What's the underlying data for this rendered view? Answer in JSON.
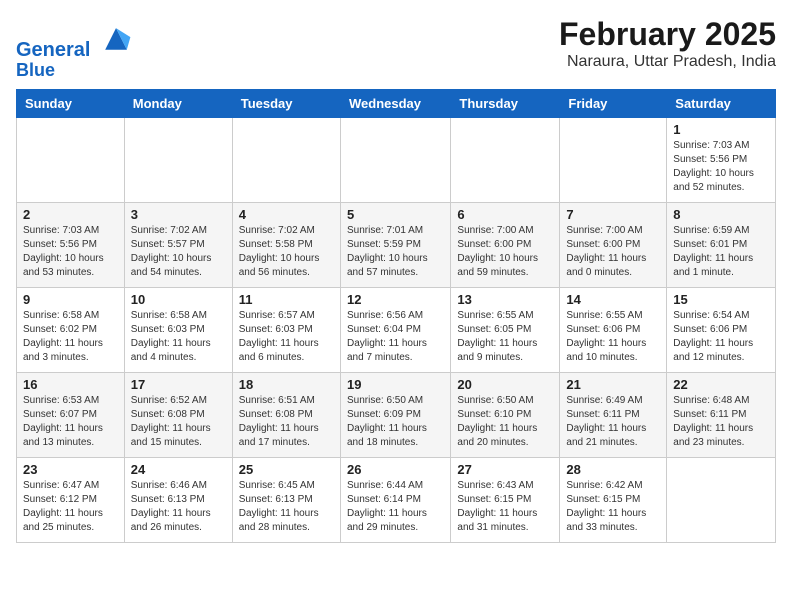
{
  "logo": {
    "line1": "General",
    "line2": "Blue"
  },
  "title": "February 2025",
  "location": "Naraura, Uttar Pradesh, India",
  "weekdays": [
    "Sunday",
    "Monday",
    "Tuesday",
    "Wednesday",
    "Thursday",
    "Friday",
    "Saturday"
  ],
  "weeks": [
    [
      {
        "day": "",
        "info": ""
      },
      {
        "day": "",
        "info": ""
      },
      {
        "day": "",
        "info": ""
      },
      {
        "day": "",
        "info": ""
      },
      {
        "day": "",
        "info": ""
      },
      {
        "day": "",
        "info": ""
      },
      {
        "day": "1",
        "info": "Sunrise: 7:03 AM\nSunset: 5:56 PM\nDaylight: 10 hours\nand 52 minutes."
      }
    ],
    [
      {
        "day": "2",
        "info": "Sunrise: 7:03 AM\nSunset: 5:56 PM\nDaylight: 10 hours\nand 53 minutes."
      },
      {
        "day": "3",
        "info": "Sunrise: 7:02 AM\nSunset: 5:57 PM\nDaylight: 10 hours\nand 54 minutes."
      },
      {
        "day": "4",
        "info": "Sunrise: 7:02 AM\nSunset: 5:58 PM\nDaylight: 10 hours\nand 56 minutes."
      },
      {
        "day": "5",
        "info": "Sunrise: 7:01 AM\nSunset: 5:59 PM\nDaylight: 10 hours\nand 57 minutes."
      },
      {
        "day": "6",
        "info": "Sunrise: 7:00 AM\nSunset: 6:00 PM\nDaylight: 10 hours\nand 59 minutes."
      },
      {
        "day": "7",
        "info": "Sunrise: 7:00 AM\nSunset: 6:00 PM\nDaylight: 11 hours\nand 0 minutes."
      },
      {
        "day": "8",
        "info": "Sunrise: 6:59 AM\nSunset: 6:01 PM\nDaylight: 11 hours\nand 1 minute."
      }
    ],
    [
      {
        "day": "9",
        "info": "Sunrise: 6:58 AM\nSunset: 6:02 PM\nDaylight: 11 hours\nand 3 minutes."
      },
      {
        "day": "10",
        "info": "Sunrise: 6:58 AM\nSunset: 6:03 PM\nDaylight: 11 hours\nand 4 minutes."
      },
      {
        "day": "11",
        "info": "Sunrise: 6:57 AM\nSunset: 6:03 PM\nDaylight: 11 hours\nand 6 minutes."
      },
      {
        "day": "12",
        "info": "Sunrise: 6:56 AM\nSunset: 6:04 PM\nDaylight: 11 hours\nand 7 minutes."
      },
      {
        "day": "13",
        "info": "Sunrise: 6:55 AM\nSunset: 6:05 PM\nDaylight: 11 hours\nand 9 minutes."
      },
      {
        "day": "14",
        "info": "Sunrise: 6:55 AM\nSunset: 6:06 PM\nDaylight: 11 hours\nand 10 minutes."
      },
      {
        "day": "15",
        "info": "Sunrise: 6:54 AM\nSunset: 6:06 PM\nDaylight: 11 hours\nand 12 minutes."
      }
    ],
    [
      {
        "day": "16",
        "info": "Sunrise: 6:53 AM\nSunset: 6:07 PM\nDaylight: 11 hours\nand 13 minutes."
      },
      {
        "day": "17",
        "info": "Sunrise: 6:52 AM\nSunset: 6:08 PM\nDaylight: 11 hours\nand 15 minutes."
      },
      {
        "day": "18",
        "info": "Sunrise: 6:51 AM\nSunset: 6:08 PM\nDaylight: 11 hours\nand 17 minutes."
      },
      {
        "day": "19",
        "info": "Sunrise: 6:50 AM\nSunset: 6:09 PM\nDaylight: 11 hours\nand 18 minutes."
      },
      {
        "day": "20",
        "info": "Sunrise: 6:50 AM\nSunset: 6:10 PM\nDaylight: 11 hours\nand 20 minutes."
      },
      {
        "day": "21",
        "info": "Sunrise: 6:49 AM\nSunset: 6:11 PM\nDaylight: 11 hours\nand 21 minutes."
      },
      {
        "day": "22",
        "info": "Sunrise: 6:48 AM\nSunset: 6:11 PM\nDaylight: 11 hours\nand 23 minutes."
      }
    ],
    [
      {
        "day": "23",
        "info": "Sunrise: 6:47 AM\nSunset: 6:12 PM\nDaylight: 11 hours\nand 25 minutes."
      },
      {
        "day": "24",
        "info": "Sunrise: 6:46 AM\nSunset: 6:13 PM\nDaylight: 11 hours\nand 26 minutes."
      },
      {
        "day": "25",
        "info": "Sunrise: 6:45 AM\nSunset: 6:13 PM\nDaylight: 11 hours\nand 28 minutes."
      },
      {
        "day": "26",
        "info": "Sunrise: 6:44 AM\nSunset: 6:14 PM\nDaylight: 11 hours\nand 29 minutes."
      },
      {
        "day": "27",
        "info": "Sunrise: 6:43 AM\nSunset: 6:15 PM\nDaylight: 11 hours\nand 31 minutes."
      },
      {
        "day": "28",
        "info": "Sunrise: 6:42 AM\nSunset: 6:15 PM\nDaylight: 11 hours\nand 33 minutes."
      },
      {
        "day": "",
        "info": ""
      }
    ]
  ]
}
